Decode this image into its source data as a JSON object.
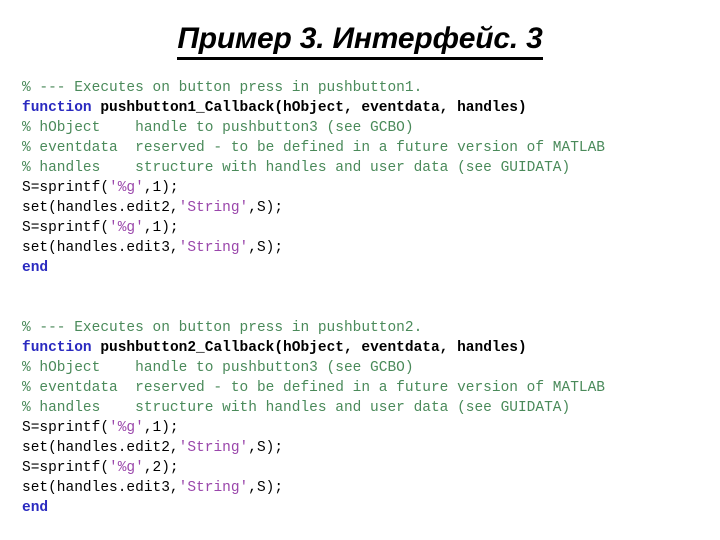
{
  "slide": {
    "title": "Пример 3. Интерфейс. 3",
    "background_color": "#ffffff"
  },
  "colors": {
    "comment_green": "#4a8a5a",
    "keyword_blue": "#2a2ac0",
    "string_purple": "#9a46ab",
    "text_black": "#000000"
  },
  "code_blocks": [
    {
      "id": "block-1",
      "lines": [
        {
          "segments": [
            {
              "text": "% --- Executes on button press in pushbutton1.",
              "style": "comment"
            }
          ]
        },
        {
          "segments": [
            {
              "text": "function ",
              "style": "keyword"
            },
            {
              "text": "pushbutton1_Callback(hObject, eventdata, handles)",
              "style": "fname"
            }
          ]
        },
        {
          "segments": [
            {
              "text": "% hObject    handle to pushbutton3 (see GCBO)",
              "style": "comment"
            }
          ]
        },
        {
          "segments": [
            {
              "text": "% eventdata  reserved - to be defined in a future version of MATLAB",
              "style": "comment"
            }
          ]
        },
        {
          "segments": [
            {
              "text": "% handles    structure with handles and user data (see GUIDATA)",
              "style": "comment"
            }
          ]
        },
        {
          "segments": [
            {
              "text": "S=sprintf(",
              "style": "plain"
            },
            {
              "text": "'%g'",
              "style": "string"
            },
            {
              "text": ",1);",
              "style": "plain"
            }
          ]
        },
        {
          "segments": [
            {
              "text": "set(handles.edit2,",
              "style": "plain"
            },
            {
              "text": "'String'",
              "style": "string"
            },
            {
              "text": ",S);",
              "style": "plain"
            }
          ]
        },
        {
          "segments": [
            {
              "text": "S=sprintf(",
              "style": "plain"
            },
            {
              "text": "'%g'",
              "style": "string"
            },
            {
              "text": ",1);",
              "style": "plain"
            }
          ]
        },
        {
          "segments": [
            {
              "text": "set(handles.edit3,",
              "style": "plain"
            },
            {
              "text": "'String'",
              "style": "string"
            },
            {
              "text": ",S);",
              "style": "plain"
            }
          ]
        },
        {
          "segments": [
            {
              "text": "end",
              "style": "keyword"
            }
          ]
        }
      ]
    },
    {
      "id": "block-2",
      "lines": [
        {
          "segments": [
            {
              "text": "% --- Executes on button press in pushbutton2.",
              "style": "comment"
            }
          ]
        },
        {
          "segments": [
            {
              "text": "function ",
              "style": "keyword"
            },
            {
              "text": "pushbutton2_Callback(hObject, eventdata, handles)",
              "style": "fname"
            }
          ]
        },
        {
          "segments": [
            {
              "text": "% hObject    handle to pushbutton3 (see GCBO)",
              "style": "comment"
            }
          ]
        },
        {
          "segments": [
            {
              "text": "% eventdata  reserved - to be defined in a future version of MATLAB",
              "style": "comment"
            }
          ]
        },
        {
          "segments": [
            {
              "text": "% handles    structure with handles and user data (see GUIDATA)",
              "style": "comment"
            }
          ]
        },
        {
          "segments": [
            {
              "text": "S=sprintf(",
              "style": "plain"
            },
            {
              "text": "'%g'",
              "style": "string"
            },
            {
              "text": ",1);",
              "style": "plain"
            }
          ]
        },
        {
          "segments": [
            {
              "text": "set(handles.edit2,",
              "style": "plain"
            },
            {
              "text": "'String'",
              "style": "string"
            },
            {
              "text": ",S);",
              "style": "plain"
            }
          ]
        },
        {
          "segments": [
            {
              "text": "S=sprintf(",
              "style": "plain"
            },
            {
              "text": "'%g'",
              "style": "string"
            },
            {
              "text": ",2);",
              "style": "plain"
            }
          ]
        },
        {
          "segments": [
            {
              "text": "set(handles.edit3,",
              "style": "plain"
            },
            {
              "text": "'String'",
              "style": "string"
            },
            {
              "text": ",S);",
              "style": "plain"
            }
          ]
        },
        {
          "segments": [
            {
              "text": "end",
              "style": "keyword"
            }
          ]
        }
      ]
    }
  ]
}
